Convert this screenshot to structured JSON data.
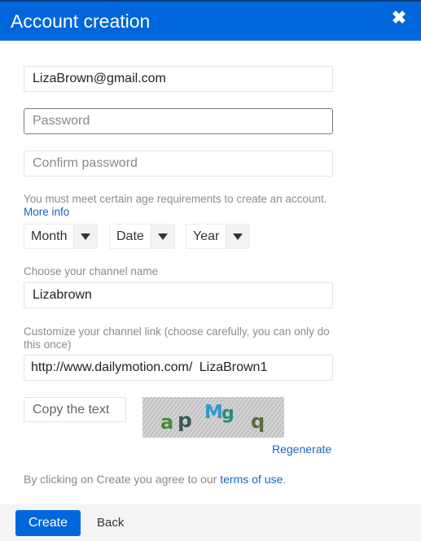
{
  "dialog": {
    "title": "Account creation",
    "close_icon": "close-icon",
    "accent_color": "#0066dc"
  },
  "form": {
    "email": {
      "value": "LizaBrown@gmail.com",
      "placeholder": ""
    },
    "password": {
      "value": "",
      "placeholder": "Password"
    },
    "confirm_password": {
      "value": "",
      "placeholder": "Confirm password"
    },
    "age_hint": "You must meet certain age requirements to create an account.",
    "age_more_info": "More info",
    "birth_month": {
      "selected": "Month"
    },
    "birth_date": {
      "selected": "Date"
    },
    "birth_year": {
      "selected": "Year"
    },
    "channel_name_label": "Choose your channel name",
    "channel_name": {
      "value": "Lizabrown"
    },
    "channel_link_label": "Customize your channel link (choose carefully, you can only do this once)",
    "channel_link_prefix": "http://www.dailymotion.com/",
    "channel_link": {
      "value": "LizaBrown1"
    },
    "captcha_input": {
      "value": "",
      "placeholder": "Copy the text"
    },
    "captcha_text": [
      "a",
      "p",
      "M",
      "g",
      "q"
    ],
    "regenerate": "Regenerate",
    "terms_prefix": "By clicking on Create you agree to our",
    "terms_link": "terms of use",
    "terms_suffix": "."
  },
  "footer": {
    "create_label": "Create",
    "back_label": "Back"
  }
}
